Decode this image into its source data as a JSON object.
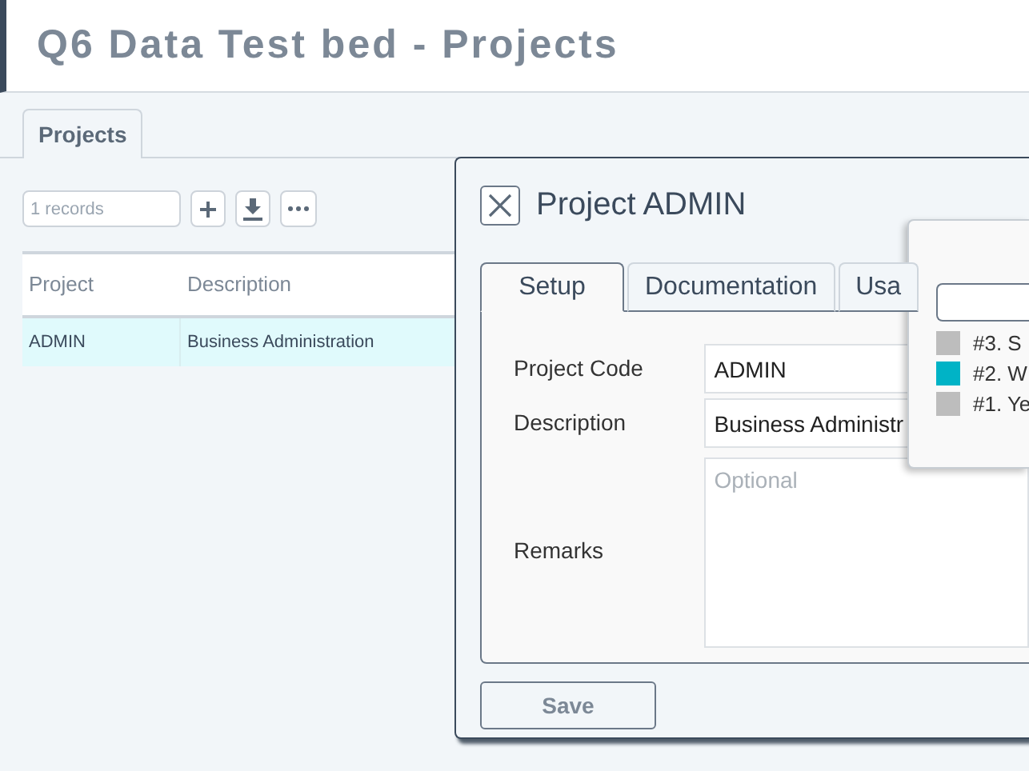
{
  "page": {
    "title": "Q6 Data Test bed - Projects"
  },
  "tabs": [
    {
      "label": "Projects",
      "selected": true
    }
  ],
  "toolbar": {
    "records_field": {
      "placeholder": "1 records"
    }
  },
  "table": {
    "columns": [
      "Project",
      "Description"
    ],
    "rows": [
      {
        "cells": [
          "ADMIN",
          "Business Administration"
        ],
        "selected": true
      }
    ]
  },
  "dialog": {
    "title": "Project ADMIN",
    "tabs": [
      {
        "label": "Setup",
        "selected": true
      },
      {
        "label": "Documentation",
        "selected": false
      },
      {
        "label": "Usa",
        "selected": false
      }
    ],
    "fields": [
      {
        "label": "Project Code",
        "value": "ADMIN",
        "kind": "text"
      },
      {
        "label": "Description",
        "value": "Business Administr",
        "kind": "text"
      },
      {
        "label": "Remarks",
        "placeholder": "Optional",
        "kind": "textarea"
      }
    ],
    "save_button": "Save"
  },
  "popup": {
    "items": [
      {
        "label": "#3. S",
        "color": "#bdbdbd"
      },
      {
        "label": "#2. W",
        "color": "#00b3c6"
      },
      {
        "label": "#1. Ye",
        "color": "#bdbdbd"
      }
    ]
  }
}
